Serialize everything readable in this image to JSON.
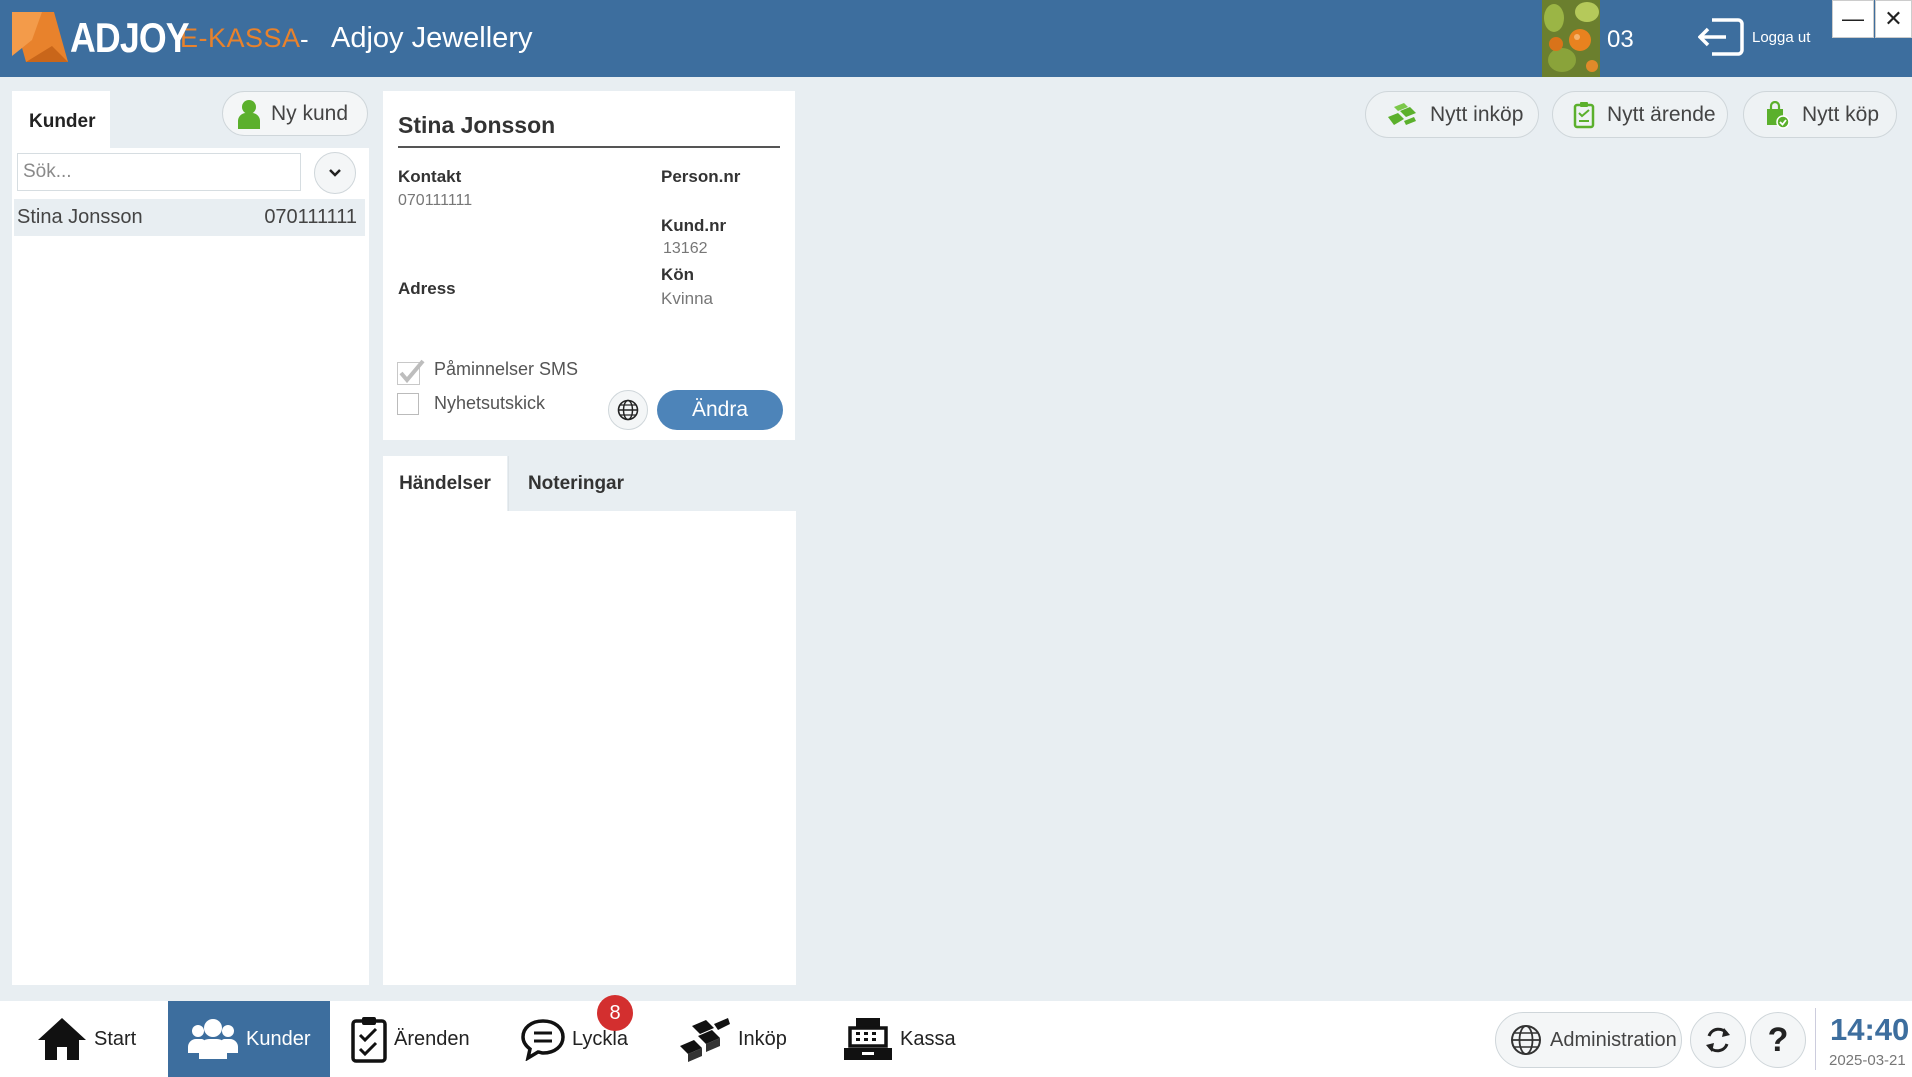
{
  "header": {
    "brand": "ADJOY",
    "product": "E-KASSA",
    "separator": "-",
    "store": "Adjoy Jewellery",
    "user_number": "03",
    "logout_label": "Logga ut",
    "minimize": "—",
    "close": "✕"
  },
  "customers_panel": {
    "tab_label": "Kunder",
    "new_customer_label": "Ny kund",
    "search_placeholder": "Sök...",
    "list": [
      {
        "name": "Stina Jonsson",
        "phone": "070111111"
      }
    ]
  },
  "customer_detail": {
    "name": "Stina Jonsson",
    "contact_label": "Kontakt",
    "contact_value": "070111111",
    "personnr_label": "Person.nr",
    "personnr_value": "",
    "kundnr_label": "Kund.nr",
    "kundnr_value": "13162",
    "address_label": "Adress",
    "gender_label": "Kön",
    "gender_value": "Kvinna",
    "sms_reminders_label": "Påminnelser SMS",
    "sms_reminders_checked": true,
    "newsletter_label": "Nyhetsutskick",
    "newsletter_checked": false,
    "edit_label": "Ändra"
  },
  "events": {
    "tabs": [
      "Händelser",
      "Noteringar"
    ],
    "active_tab": "Händelser"
  },
  "actions": {
    "new_purchase": "Nytt inköp",
    "new_case": "Nytt ärende",
    "new_sale": "Nytt köp"
  },
  "bottom_nav": {
    "items": [
      {
        "label": "Start",
        "icon": "home-icon"
      },
      {
        "label": "Kunder",
        "icon": "users-icon",
        "active": true
      },
      {
        "label": "Ärenden",
        "icon": "clipboard-icon"
      },
      {
        "label": "Lyckla",
        "icon": "chat-icon",
        "badge": "8"
      },
      {
        "label": "Inköp",
        "icon": "gold-bars-icon"
      },
      {
        "label": "Kassa",
        "icon": "cash-register-icon"
      }
    ],
    "admin_label": "Administration",
    "help_label": "?",
    "time": "14:40",
    "date": "2025-03-21"
  },
  "colors": {
    "header_bg": "#3d6e9e",
    "accent_orange": "#e8822c",
    "primary_button": "#4d84b9",
    "icon_green": "#5bb02c",
    "badge_red": "#d32f2f",
    "page_bg": "#e8eef2"
  }
}
